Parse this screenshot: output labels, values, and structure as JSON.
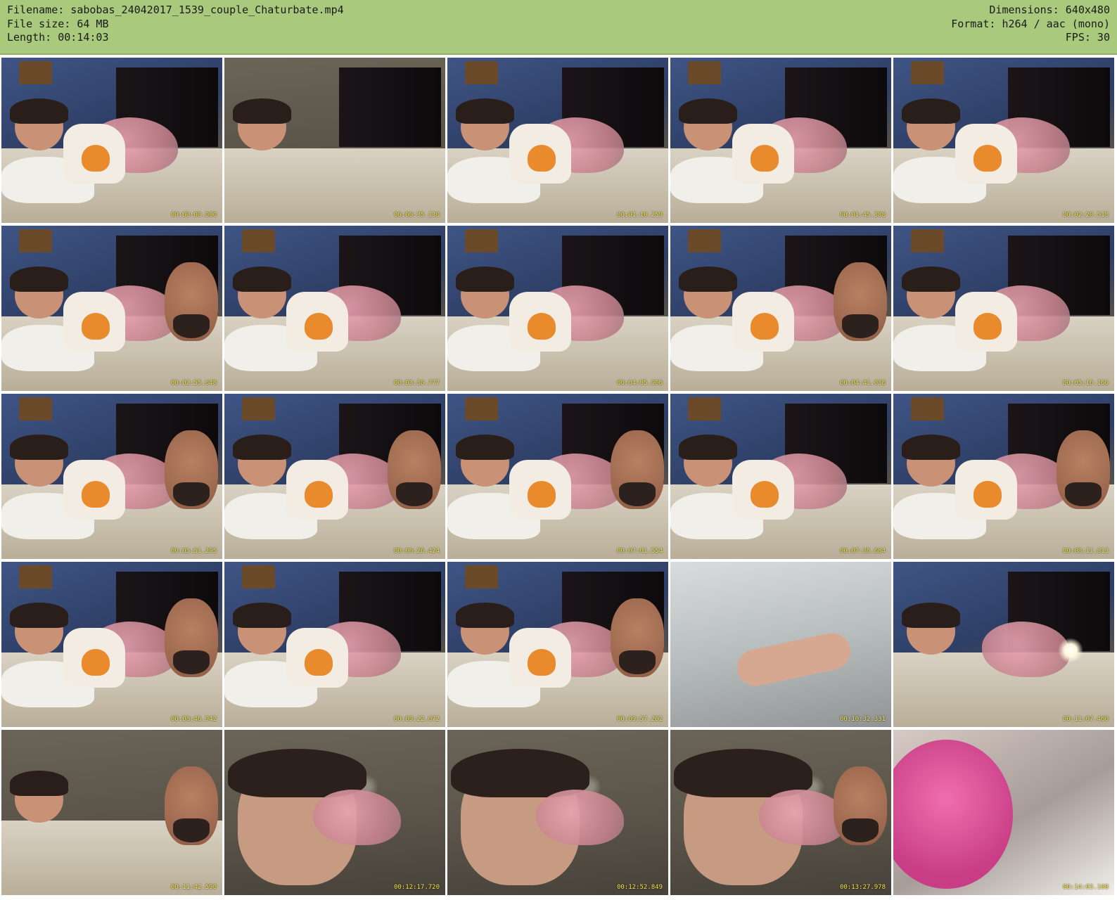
{
  "header": {
    "filename": "Filename: sabobas_24042017_1539_couple_Chaturbate.mp4",
    "filesize": "File size: 64 MB",
    "length": "Length: 00:14:03",
    "dimensions": "Dimensions: 640x480",
    "format": "Format: h264 / aac (mono)",
    "fps": "FPS: 30"
  },
  "colors": {
    "header_bg": "#a9c97d",
    "timestamp": "#f3e64a"
  },
  "thumbnails": [
    {
      "time": "00:00:00.000",
      "scene": "bedroom-woman"
    },
    {
      "time": "00:00:35.130",
      "scene": "bedroom-ceiling"
    },
    {
      "time": "00:01:10.259",
      "scene": "bedroom-woman"
    },
    {
      "time": "00:01:45.388",
      "scene": "bedroom-woman"
    },
    {
      "time": "00:02:20.518",
      "scene": "bedroom-woman"
    },
    {
      "time": "00:02:55.648",
      "scene": "bedroom-couple"
    },
    {
      "time": "00:03:30.777",
      "scene": "bedroom-woman"
    },
    {
      "time": "00:04:05.906",
      "scene": "bedroom-woman"
    },
    {
      "time": "00:04:41.036",
      "scene": "bedroom-couple"
    },
    {
      "time": "00:05:16.166",
      "scene": "bedroom-woman"
    },
    {
      "time": "00:05:51.295",
      "scene": "bedroom-couple"
    },
    {
      "time": "00:06:26.424",
      "scene": "bedroom-couple"
    },
    {
      "time": "00:07:01.554",
      "scene": "bedroom-couple"
    },
    {
      "time": "00:07:36.684",
      "scene": "bedroom-woman"
    },
    {
      "time": "00:08:11.813",
      "scene": "bedroom-couple"
    },
    {
      "time": "00:08:46.942",
      "scene": "bedroom-couple"
    },
    {
      "time": "00:09:22.072",
      "scene": "bedroom-woman"
    },
    {
      "time": "00:09:57.202",
      "scene": "bedroom-couple"
    },
    {
      "time": "00:10:32.331",
      "scene": "bright-room"
    },
    {
      "time": "00:11:07.460",
      "scene": "flash"
    },
    {
      "time": "00:11:42.590",
      "scene": "ceiling-dark"
    },
    {
      "time": "00:12:17.720",
      "scene": "closeup"
    },
    {
      "time": "00:12:52.849",
      "scene": "closeup"
    },
    {
      "time": "00:13:27.978",
      "scene": "closeup-couple"
    },
    {
      "time": "00:14:03.108",
      "scene": "pink-blur"
    }
  ]
}
